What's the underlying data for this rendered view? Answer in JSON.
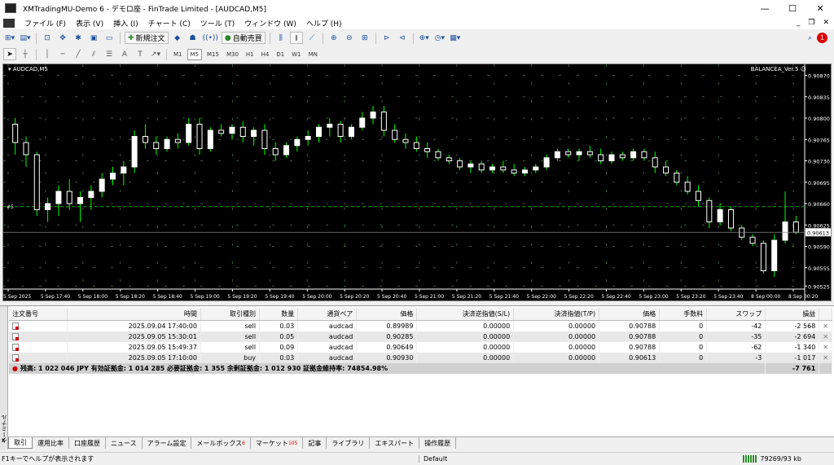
{
  "window": {
    "title": "XMTradingMU-Demo 6 - デモロ座 - FinTrade Limited - [AUDCAD,M5]",
    "min": "—",
    "max": "☐",
    "close": "✕"
  },
  "menu": [
    "ファイル (F)",
    "表示 (V)",
    "挿入 (I)",
    "チャート (C)",
    "ツール (T)",
    "ウィンドウ (W)",
    "ヘルプ (H)"
  ],
  "toolbar": {
    "new_order": "新規注文",
    "auto_trade": "自動売買"
  },
  "timeframes": [
    "M1",
    "M5",
    "M15",
    "M30",
    "H1",
    "H4",
    "D1",
    "W1",
    "MN"
  ],
  "active_timeframe": "M5",
  "chart": {
    "symbol": "AUDCAD,M5",
    "expert": "BALANCEA_Ver.5",
    "hline_label": "#5",
    "current_price": "0.90613",
    "price_labels": [
      "0.90870",
      "0.90835",
      "0.90800",
      "0.90765",
      "0.90730",
      "0.90695",
      "0.90660",
      "0.90625",
      "0.90590",
      "0.90555",
      "0.90525"
    ],
    "time_labels": [
      "5 Sep 2025",
      "5 Sep 17:40",
      "5 Sep 18:00",
      "5 Sep 18:20",
      "5 Sep 18:40",
      "5 Sep 19:00",
      "5 Sep 19:20",
      "5 Sep 19:40",
      "5 Sep 20:00",
      "5 Sep 20:20",
      "5 Sep 20:40",
      "5 Sep 21:00",
      "5 Sep 21:20",
      "5 Sep 21:40",
      "5 Sep 22:00",
      "5 Sep 22:20",
      "5 Sep 22:40",
      "5 Sep 23:00",
      "5 Sep 23:20",
      "5 Sep 23:40",
      "8 Sep 00:00",
      "8 Sep 00:20"
    ],
    "colors": {
      "bg": "#000000",
      "bull": "#ffffff",
      "bear": "#ffffff",
      "wick": "#00ff00",
      "grid": "#3a5a3a",
      "hline": "#00aa00",
      "axis": "#ffffff"
    },
    "candles": [
      [
        0.9079,
        0.908,
        0.9074,
        0.9076
      ],
      [
        0.9076,
        0.9077,
        0.9072,
        0.9074
      ],
      [
        0.9074,
        0.90745,
        0.9064,
        0.9065
      ],
      [
        0.9065,
        0.9067,
        0.9063,
        0.9066
      ],
      [
        0.9066,
        0.9069,
        0.9064,
        0.9068
      ],
      [
        0.9068,
        0.907,
        0.9065,
        0.9066
      ],
      [
        0.9066,
        0.9068,
        0.9063,
        0.9067
      ],
      [
        0.9067,
        0.9069,
        0.9065,
        0.9068
      ],
      [
        0.9068,
        0.9071,
        0.9067,
        0.907
      ],
      [
        0.907,
        0.9072,
        0.9069,
        0.9071
      ],
      [
        0.9071,
        0.9073,
        0.9069,
        0.9072
      ],
      [
        0.9072,
        0.9078,
        0.9071,
        0.9077
      ],
      [
        0.9077,
        0.9079,
        0.9075,
        0.9076
      ],
      [
        0.9076,
        0.9077,
        0.9074,
        0.9075
      ],
      [
        0.9075,
        0.9077,
        0.90745,
        0.90765
      ],
      [
        0.90765,
        0.90775,
        0.9075,
        0.9076
      ],
      [
        0.9076,
        0.908,
        0.90755,
        0.9079
      ],
      [
        0.9079,
        0.908,
        0.9074,
        0.9075
      ],
      [
        0.9075,
        0.90785,
        0.90745,
        0.9078
      ],
      [
        0.9078,
        0.9079,
        0.9077,
        0.90775
      ],
      [
        0.90775,
        0.9079,
        0.90765,
        0.90785
      ],
      [
        0.90785,
        0.90795,
        0.9076,
        0.9077
      ],
      [
        0.9077,
        0.90785,
        0.90755,
        0.9078
      ],
      [
        0.9078,
        0.9079,
        0.9074,
        0.9075
      ],
      [
        0.9075,
        0.9076,
        0.9073,
        0.9074
      ],
      [
        0.9074,
        0.9076,
        0.90735,
        0.90755
      ],
      [
        0.90755,
        0.9077,
        0.90745,
        0.90765
      ],
      [
        0.90765,
        0.9078,
        0.90755,
        0.9077
      ],
      [
        0.9077,
        0.9079,
        0.9076,
        0.90785
      ],
      [
        0.90785,
        0.908,
        0.9077,
        0.9079
      ],
      [
        0.9079,
        0.90795,
        0.9076,
        0.9077
      ],
      [
        0.9077,
        0.9079,
        0.90765,
        0.90785
      ],
      [
        0.90785,
        0.9081,
        0.9078,
        0.908
      ],
      [
        0.908,
        0.9082,
        0.9079,
        0.9081
      ],
      [
        0.9081,
        0.9082,
        0.9077,
        0.9078
      ],
      [
        0.9078,
        0.9079,
        0.9076,
        0.90765
      ],
      [
        0.90765,
        0.90775,
        0.9075,
        0.9076
      ],
      [
        0.9076,
        0.9077,
        0.90745,
        0.9075
      ],
      [
        0.9075,
        0.9076,
        0.90735,
        0.90745
      ],
      [
        0.90745,
        0.9075,
        0.9073,
        0.90735
      ],
      [
        0.90735,
        0.9074,
        0.90725,
        0.9073
      ],
      [
        0.9073,
        0.90735,
        0.90715,
        0.9072
      ],
      [
        0.9072,
        0.9073,
        0.9071,
        0.90725
      ],
      [
        0.90725,
        0.9073,
        0.9071,
        0.90715
      ],
      [
        0.90715,
        0.90725,
        0.9071,
        0.9072
      ],
      [
        0.9072,
        0.9073,
        0.9071,
        0.90715
      ],
      [
        0.90715,
        0.90725,
        0.90705,
        0.9071
      ],
      [
        0.9071,
        0.9072,
        0.90705,
        0.90715
      ],
      [
        0.90715,
        0.90725,
        0.9071,
        0.9072
      ],
      [
        0.9072,
        0.9074,
        0.90715,
        0.90735
      ],
      [
        0.90735,
        0.9075,
        0.9073,
        0.90745
      ],
      [
        0.90745,
        0.9075,
        0.90735,
        0.9074
      ],
      [
        0.9074,
        0.9075,
        0.9073,
        0.90745
      ],
      [
        0.90745,
        0.90755,
        0.90735,
        0.9074
      ],
      [
        0.9074,
        0.9075,
        0.90725,
        0.9073
      ],
      [
        0.9073,
        0.90745,
        0.90725,
        0.9074
      ],
      [
        0.9074,
        0.90745,
        0.9073,
        0.90735
      ],
      [
        0.90735,
        0.9075,
        0.9073,
        0.90745
      ],
      [
        0.90745,
        0.9075,
        0.9073,
        0.90735
      ],
      [
        0.90735,
        0.90745,
        0.9071,
        0.9072
      ],
      [
        0.9072,
        0.9073,
        0.90705,
        0.9071
      ],
      [
        0.9071,
        0.90715,
        0.9069,
        0.90695
      ],
      [
        0.90695,
        0.90705,
        0.90675,
        0.9068
      ],
      [
        0.9068,
        0.9069,
        0.90655,
        0.90665
      ],
      [
        0.90665,
        0.9067,
        0.9062,
        0.9063
      ],
      [
        0.9063,
        0.9066,
        0.90625,
        0.9065
      ],
      [
        0.9065,
        0.90655,
        0.90615,
        0.9062
      ],
      [
        0.9062,
        0.90625,
        0.906,
        0.90605
      ],
      [
        0.90605,
        0.9061,
        0.9059,
        0.90595
      ],
      [
        0.90595,
        0.906,
        0.90545,
        0.9055
      ],
      [
        0.9055,
        0.9061,
        0.9054,
        0.906
      ],
      [
        0.906,
        0.9068,
        0.90595,
        0.9063
      ],
      [
        0.9063,
        0.9064,
        0.9061,
        0.90613
      ]
    ]
  },
  "orders": {
    "headers": [
      "注文番号",
      "時間",
      "取引種別",
      "数量",
      "通貨ペア",
      "価格",
      "決済逆指値(S/L)",
      "決済指値(T/P)",
      "価格",
      "手数料",
      "スワップ",
      "損益"
    ],
    "rows": [
      {
        "time": "2025.09.04 17:40:00",
        "type": "sell",
        "volume": "0.03",
        "symbol": "audcad",
        "price": "0.89989",
        "sl": "0.00000",
        "tp": "0.00000",
        "cur": "0.90788",
        "comm": "0",
        "swap": "-42",
        "profit": "-2 568"
      },
      {
        "time": "2025.09.05 15:30:01",
        "type": "sell",
        "volume": "0.05",
        "symbol": "audcad",
        "price": "0.90285",
        "sl": "0.00000",
        "tp": "0.00000",
        "cur": "0.90788",
        "comm": "0",
        "swap": "-35",
        "profit": "-2 694"
      },
      {
        "time": "2025.09.05 15:49:37",
        "type": "sell",
        "volume": "0.09",
        "symbol": "audcad",
        "price": "0.90649",
        "sl": "0.00000",
        "tp": "0.00000",
        "cur": "0.90788",
        "comm": "0",
        "swap": "-62",
        "profit": "-1 340"
      },
      {
        "time": "2025.09.05 17:10:00",
        "type": "buy",
        "volume": "0.03",
        "symbol": "audcad",
        "price": "0.90930",
        "sl": "0.00000",
        "tp": "0.00000",
        "cur": "0.90613",
        "comm": "0",
        "swap": "-3",
        "profit": "-1 017"
      }
    ],
    "summary": "残高: 1 022 046 JPY  有効証拠金: 1 014 285  必要証拠金: 1 355  余剰証拠金: 1 012 930  証拠金維持率: 74854.98%",
    "summary_profit": "-7 761"
  },
  "terminal_label": "ターミナル",
  "tabs": [
    {
      "label": "取引"
    },
    {
      "label": "運用比率"
    },
    {
      "label": "口座履歴"
    },
    {
      "label": "ニュース"
    },
    {
      "label": "アラーム設定"
    },
    {
      "label": "メールボックス",
      "badge": "6"
    },
    {
      "label": "マーケット",
      "badge": "105"
    },
    {
      "label": "記事"
    },
    {
      "label": "ライブラリ"
    },
    {
      "label": "エキスパート"
    },
    {
      "label": "操作履歴"
    }
  ],
  "status": {
    "help": "F1キーでヘルプが表示されます",
    "profile": "Default",
    "traffic": "79269/93 kb"
  }
}
